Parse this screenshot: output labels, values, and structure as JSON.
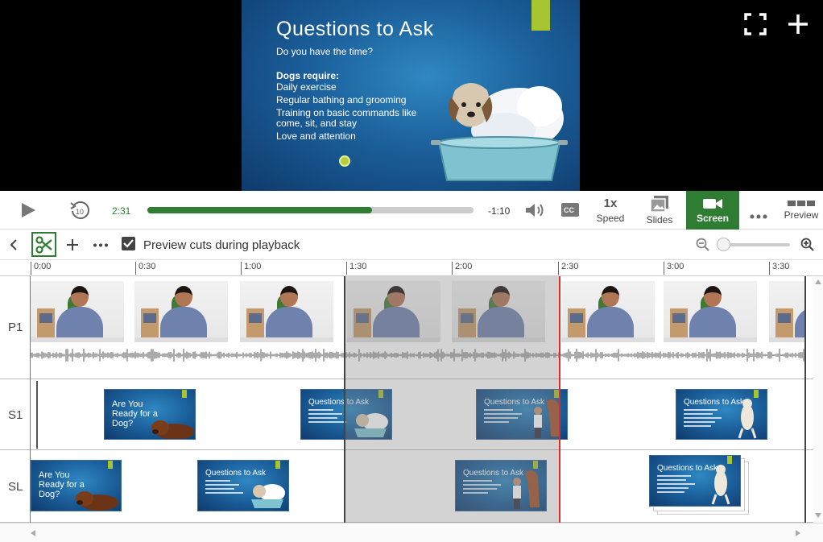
{
  "video": {
    "slide": {
      "title": "Questions to Ask",
      "subtitle": "Do you have the time?",
      "heading": "Dogs require:",
      "bullets": [
        "Daily exercise",
        "Regular bathing and grooming",
        "Training on basic commands like come, sit, and stay",
        "Love and attention"
      ]
    },
    "icons": {
      "fullscreen": "fullscreen-icon",
      "add": "plus-icon"
    }
  },
  "playback": {
    "current_time": "2:31",
    "remaining_time": "-1:10",
    "progress_fraction": 0.688,
    "speed_value": "1x",
    "speed_label": "Speed",
    "slides_label": "Slides",
    "screen_label": "Screen",
    "preview_label": "Preview",
    "accent_color": "#2e7d32"
  },
  "edit_toolbar": {
    "preview_cuts_label": "Preview cuts during playback",
    "preview_cuts_checked": true
  },
  "ruler": {
    "ticks": [
      "0:00",
      "0:30",
      "1:00",
      "1:30",
      "2:00",
      "2:30",
      "3:00",
      "3:30"
    ]
  },
  "tracks": {
    "labels": [
      "P1",
      "S1",
      "SL"
    ],
    "slide_titles": {
      "ready": "Are You Ready for a Dog?",
      "questions": "Questions to Ask"
    }
  }
}
